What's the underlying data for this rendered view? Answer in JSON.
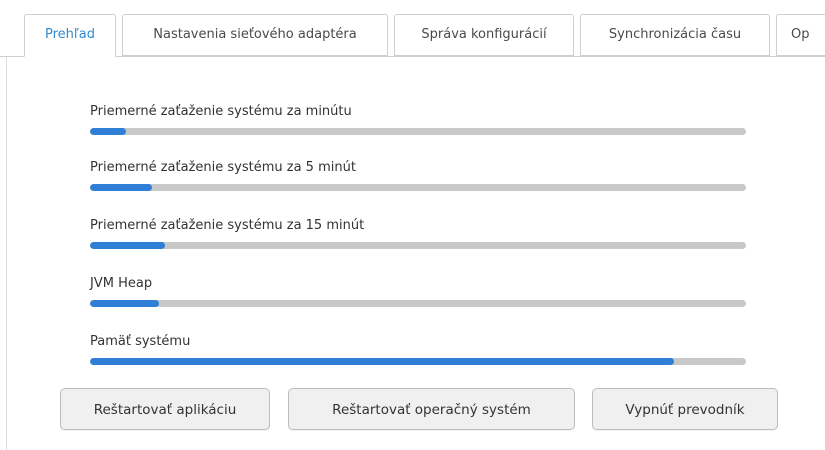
{
  "tabs": [
    {
      "label": "Prehľad",
      "active": true
    },
    {
      "label": "Nastavenia sieťového adaptéra",
      "active": false
    },
    {
      "label": "Správa konfigurácií",
      "active": false
    },
    {
      "label": "Synchronizácia času",
      "active": false
    },
    {
      "label": "Op",
      "active": false
    }
  ],
  "metrics": [
    {
      "label": "Priemerné zaťaženie systému za minútu",
      "fraction": 0.055
    },
    {
      "label": "Priemerné zaťaženie systému za 5 minút",
      "fraction": 0.095
    },
    {
      "label": "Priemerné zaťaženie systému za 15 minút",
      "fraction": 0.115
    },
    {
      "label": "JVM Heap",
      "fraction": 0.105
    },
    {
      "label": "Pamäť systému",
      "fraction": 0.89
    }
  ],
  "buttons": {
    "restart_app": "Reštartovať aplikáciu",
    "restart_os": "Reštartovať operačný systém",
    "shutdown": "Vypnúť prevodník"
  },
  "colors": {
    "accent": "#2f8ad0",
    "bar_fill": "#2f7fd6",
    "bar_track": "#c8c8c8"
  }
}
